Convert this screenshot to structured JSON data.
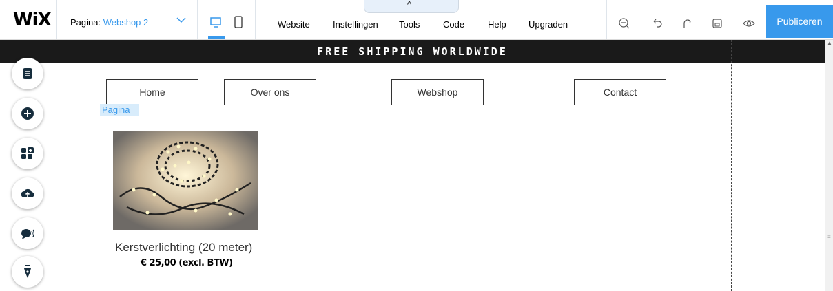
{
  "app": {
    "logo": "WiX",
    "page_label": "Pagina:",
    "page_value": "Webshop 2",
    "menu": [
      "Website",
      "Instellingen",
      "Tools",
      "Code",
      "Help",
      "Upgraden"
    ],
    "collapse_glyph": "^",
    "publish_label": "Publiceren",
    "accent_color": "#3899ec"
  },
  "icons": {
    "device": [
      "desktop-icon",
      "mobile-icon"
    ],
    "tools": [
      "zoom-out-icon",
      "undo-icon",
      "redo-icon",
      "save-icon",
      "preview-eye-icon"
    ],
    "sidebar": [
      "pages-menu-icon",
      "add-icon",
      "add-apps-icon",
      "upload-media-icon",
      "chat-icon",
      "pen-design-icon"
    ]
  },
  "site": {
    "banner": "FREE SHIPPING WORLDWIDE",
    "nav": [
      "Home",
      "Over ons",
      "Webshop",
      "Contact"
    ],
    "section_tag": "Pagina",
    "product": {
      "name": "Kerstverlichting (20 meter)",
      "price": "€ 25,00 (excl. BTW)"
    }
  }
}
